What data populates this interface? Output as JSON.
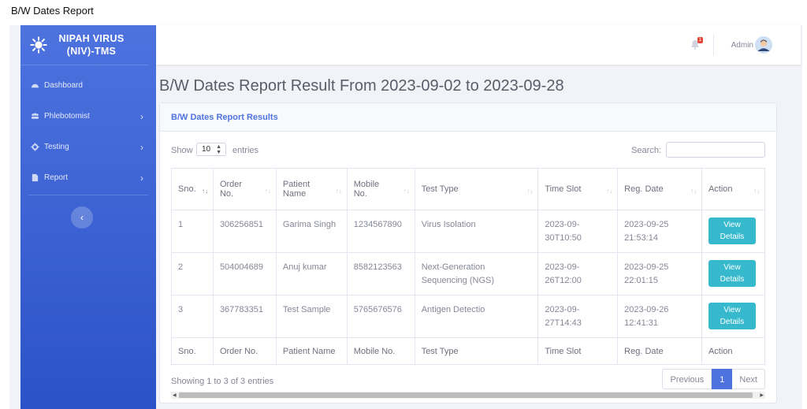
{
  "caption": "B/W Dates Report",
  "brand": {
    "line1": "NIPAH VIRUS",
    "line2": "(NIV)-TMS"
  },
  "sidebar": {
    "items": [
      {
        "label": "Dashboard"
      },
      {
        "label": "Phlebotomist",
        "chevron": "›"
      },
      {
        "label": "Testing",
        "chevron": "›"
      },
      {
        "label": "Report",
        "chevron": "›"
      }
    ],
    "collapse_glyph": "‹"
  },
  "topbar": {
    "badge": "1",
    "user": "Admin"
  },
  "page": {
    "title": "B/W Dates Report Result From 2023-09-02 to 2023-09-28"
  },
  "card": {
    "header": "B/W Dates Report Results"
  },
  "controls": {
    "show": "Show",
    "length": "10",
    "entries": "entries",
    "search_label": "Search:",
    "search_value": ""
  },
  "table": {
    "headers": [
      {
        "line1": "Sno.",
        "line2": ""
      },
      {
        "line1": "Order",
        "line2": "No."
      },
      {
        "line1": "Patient",
        "line2": "Name"
      },
      {
        "line1": "Mobile",
        "line2": "No."
      },
      {
        "line1": "Test Type",
        "line2": ""
      },
      {
        "line1": "Time Slot",
        "line2": ""
      },
      {
        "line1": "Reg. Date",
        "line2": ""
      },
      {
        "line1": "Action",
        "line2": ""
      }
    ],
    "rows": [
      {
        "sno": "1",
        "order": "306256851",
        "name": "Garima Singh",
        "mobile": "1234567890",
        "test1": "Virus Isolation",
        "test2": "",
        "slot1": "2023-09-",
        "slot2": "30T10:50",
        "reg1": "2023-09-25",
        "reg2": "21:53:14",
        "action1": "View",
        "action2": "Details"
      },
      {
        "sno": "2",
        "order": "504004689",
        "name": "Anuj kumar",
        "mobile": "8582123563",
        "test1": "Next-Generation",
        "test2": "Sequencing (NGS)",
        "slot1": "2023-09-",
        "slot2": "26T12:00",
        "reg1": "2023-09-25",
        "reg2": "22:01:15",
        "action1": "View",
        "action2": "Details"
      },
      {
        "sno": "3",
        "order": "367783351",
        "name": "Test Sample",
        "mobile": "5765676576",
        "test1": "Antigen Detectio",
        "test2": "",
        "slot1": "2023-09-",
        "slot2": "27T14:43",
        "reg1": "2023-09-26",
        "reg2": "12:41:31",
        "action1": "View",
        "action2": "Details"
      }
    ],
    "footers": [
      "Sno.",
      "Order No.",
      "Patient Name",
      "Mobile No.",
      "Test Type",
      "Time Slot",
      "Reg. Date",
      "Action"
    ]
  },
  "info": "Showing 1 to 3 of 3 entries",
  "pagination": {
    "prev": "Previous",
    "page": "1",
    "next": "Next"
  },
  "colors": {
    "primary": "#4e73df",
    "info": "#36b9cc",
    "danger": "#e74a3b"
  }
}
